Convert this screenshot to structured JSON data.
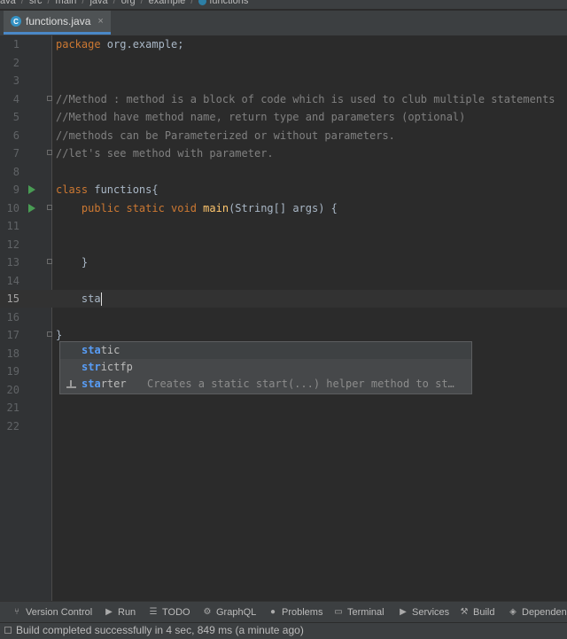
{
  "breadcrumb": [
    "ava",
    "src",
    "main",
    "java",
    "org",
    "example",
    "functions"
  ],
  "tab": {
    "label": "functions.java",
    "close": "×"
  },
  "lines": [
    {
      "n": "1",
      "tokens": [
        {
          "t": "package",
          "c": "kw"
        },
        {
          "t": " org.example;",
          "c": ""
        }
      ]
    },
    {
      "n": "2",
      "tokens": []
    },
    {
      "n": "3",
      "tokens": []
    },
    {
      "n": "4",
      "tokens": [
        {
          "t": "//Method : method is a block of code which is used to club multiple statements",
          "c": "cm"
        }
      ]
    },
    {
      "n": "5",
      "tokens": [
        {
          "t": "//Method have method name, return type and parameters (optional)",
          "c": "cm"
        }
      ]
    },
    {
      "n": "6",
      "tokens": [
        {
          "t": "//methods can be Parameterized or without parameters.",
          "c": "cm"
        }
      ]
    },
    {
      "n": "7",
      "tokens": [
        {
          "t": "//let's see method with parameter.",
          "c": "cm"
        }
      ]
    },
    {
      "n": "8",
      "tokens": []
    },
    {
      "n": "9",
      "tokens": [
        {
          "t": "class",
          "c": "kw"
        },
        {
          "t": " functions{",
          "c": ""
        }
      ]
    },
    {
      "n": "10",
      "tokens": [
        {
          "t": "    public static void ",
          "c": "kw"
        },
        {
          "t": "main",
          "c": "fn"
        },
        {
          "t": "(String[] args) {",
          "c": ""
        }
      ]
    },
    {
      "n": "11",
      "tokens": []
    },
    {
      "n": "12",
      "tokens": []
    },
    {
      "n": "13",
      "tokens": [
        {
          "t": "    }",
          "c": ""
        }
      ]
    },
    {
      "n": "14",
      "tokens": []
    },
    {
      "n": "15",
      "tokens": [
        {
          "t": "    sta",
          "c": ""
        }
      ]
    },
    {
      "n": "16",
      "tokens": []
    },
    {
      "n": "17",
      "tokens": [
        {
          "t": "}",
          "c": ""
        }
      ]
    },
    {
      "n": "18",
      "tokens": []
    },
    {
      "n": "19",
      "tokens": []
    },
    {
      "n": "20",
      "tokens": []
    },
    {
      "n": "21",
      "tokens": []
    },
    {
      "n": "22",
      "tokens": []
    }
  ],
  "completion": [
    {
      "match": "sta",
      "rest": "tic",
      "desc": ""
    },
    {
      "match": "str",
      "rest": "ictfp",
      "desc": ""
    },
    {
      "match": "sta",
      "rest": "rter",
      "desc": "Creates a static start(...) helper method to st…"
    }
  ],
  "toolwindows": [
    {
      "label": "Version Control",
      "icon": "branch-icon",
      "glyph": "⑂"
    },
    {
      "label": "Run",
      "icon": "play-icon",
      "glyph": "▶"
    },
    {
      "label": "TODO",
      "icon": "list-icon",
      "glyph": "☰"
    },
    {
      "label": "GraphQL",
      "icon": "graphql-icon",
      "glyph": "⚙"
    },
    {
      "label": "Problems",
      "icon": "warning-icon",
      "glyph": "●"
    },
    {
      "label": "Terminal",
      "icon": "terminal-icon",
      "glyph": "▭"
    },
    {
      "label": "Services",
      "icon": "services-icon",
      "glyph": "▶"
    },
    {
      "label": "Build",
      "icon": "hammer-icon",
      "glyph": "⚒"
    },
    {
      "label": "Dependenc",
      "icon": "dependencies-icon",
      "glyph": "◈"
    }
  ],
  "status": "Build completed successfully in 4 sec, 849 ms (a minute ago)"
}
